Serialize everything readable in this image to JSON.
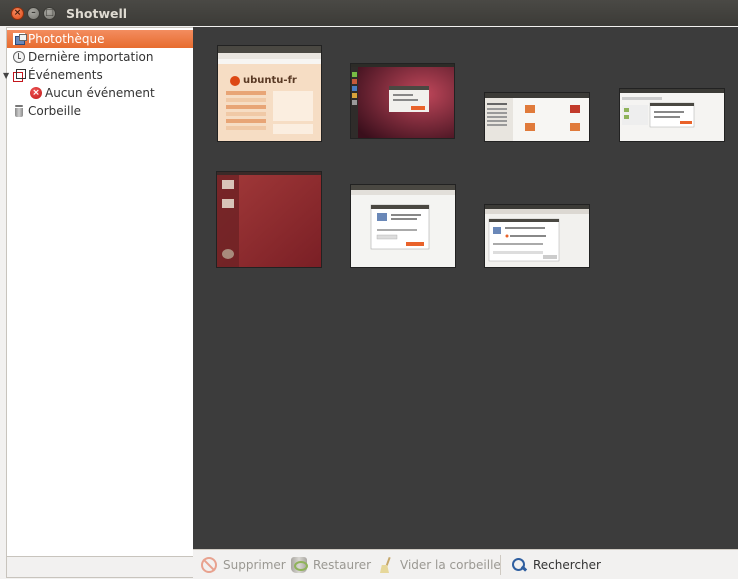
{
  "window": {
    "title": "Shotwell",
    "close_glyph": "×",
    "min_glyph": "–",
    "max_glyph": "□"
  },
  "sidebar": {
    "items": [
      {
        "label": "Photothèque",
        "icon": "library-icon",
        "selected": true
      },
      {
        "label": "Dernière importation",
        "icon": "last-import-icon",
        "selected": false
      },
      {
        "label": "Événements",
        "icon": "events-icon",
        "selected": false,
        "expanded": true
      },
      {
        "label": "Aucun événement",
        "icon": "no-event-icon",
        "selected": false
      },
      {
        "label": "Corbeille",
        "icon": "trash-icon",
        "selected": false
      }
    ],
    "expander_glyph": "▼",
    "noevent_glyph": "×"
  },
  "toolbar": {
    "delete_label": "Supprimer",
    "restore_label": "Restaurer",
    "empty_trash_label": "Vider la corbeille",
    "search_label": "Rechercher"
  },
  "thumbnails": [
    {
      "name": "photo-thumbnail-ubuntu-fr",
      "caption": "ubuntu-fr"
    },
    {
      "name": "photo-thumbnail-desktop-dialog"
    },
    {
      "name": "photo-thumbnail-file-manager"
    },
    {
      "name": "photo-thumbnail-settings-window"
    },
    {
      "name": "photo-thumbnail-red-desktop"
    },
    {
      "name": "photo-thumbnail-dialog-white"
    },
    {
      "name": "photo-thumbnail-preferences"
    }
  ],
  "colors": {
    "accent": "#e76b2e",
    "viewer_bg": "#3c3c3c",
    "titlebar": "#3c3b37"
  }
}
